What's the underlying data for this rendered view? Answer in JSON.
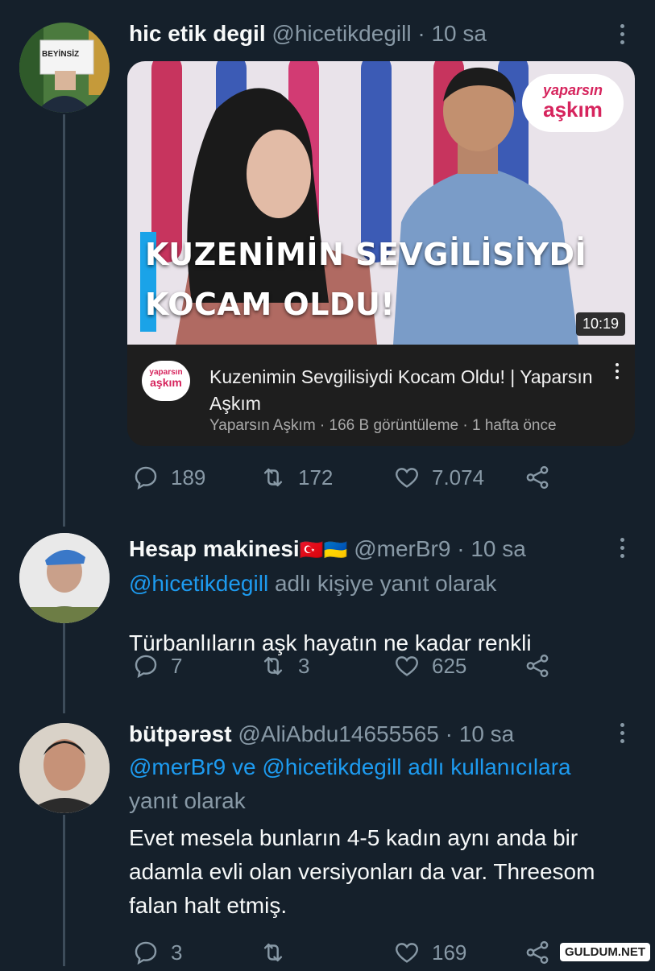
{
  "tweets": [
    {
      "name": "hic etik degil",
      "handle": "@hicetikdegill",
      "time": "· 10 sa",
      "avatar_text": "BEYİNSİZ",
      "card": {
        "badge_top": "yaparsın",
        "badge_bottom": "aşkım",
        "headline_1": "KUZENİMİN SEVGİLİSİYDİ",
        "headline_2": "KOCAM OLDU!",
        "duration": "10:19",
        "logo_top": "yaparsın",
        "logo_bottom": "aşkım",
        "video_title": "Kuzenimin Sevgilisiydi Kocam Oldu! | Yaparsın Aşkım",
        "video_meta": "Yaparsın Aşkım · 166 B görüntüleme · 1 hafta önce"
      },
      "replies": "189",
      "retweets": "172",
      "likes": "7.074"
    },
    {
      "name": "Hesap makinesi",
      "flags": [
        "🇹🇷",
        "🇺🇦"
      ],
      "handle": "@merBr9",
      "time": "· 10 sa",
      "reply_link": "@hicetikdegill",
      "reply_suffix": " adlı kişiye yanıt olarak",
      "text": "Türbanlıların aşk hayatın ne kadar renkli",
      "replies": "7",
      "retweets": "3",
      "likes": "625"
    },
    {
      "name": "bütpərəst",
      "handle": "@AliAbdu14655565",
      "time": "· 10 sa",
      "reply_link": "@merBr9 ve @hicetikdegill adlı kullanıcılara",
      "reply_suffix": "yanıt olarak",
      "text": "Evet mesela bunların 4-5 kadın aynı anda bir adamla evli olan versiyonları da var. Threesom falan halt etmiş.",
      "replies": "3",
      "retweets": "",
      "likes": "169"
    }
  ],
  "watermark": "GULDUM.NET",
  "colors": {
    "background": "#15202b",
    "secondary_text": "#8899a6",
    "link": "#1d9bf0",
    "thread_line": "#3d4c5a"
  }
}
